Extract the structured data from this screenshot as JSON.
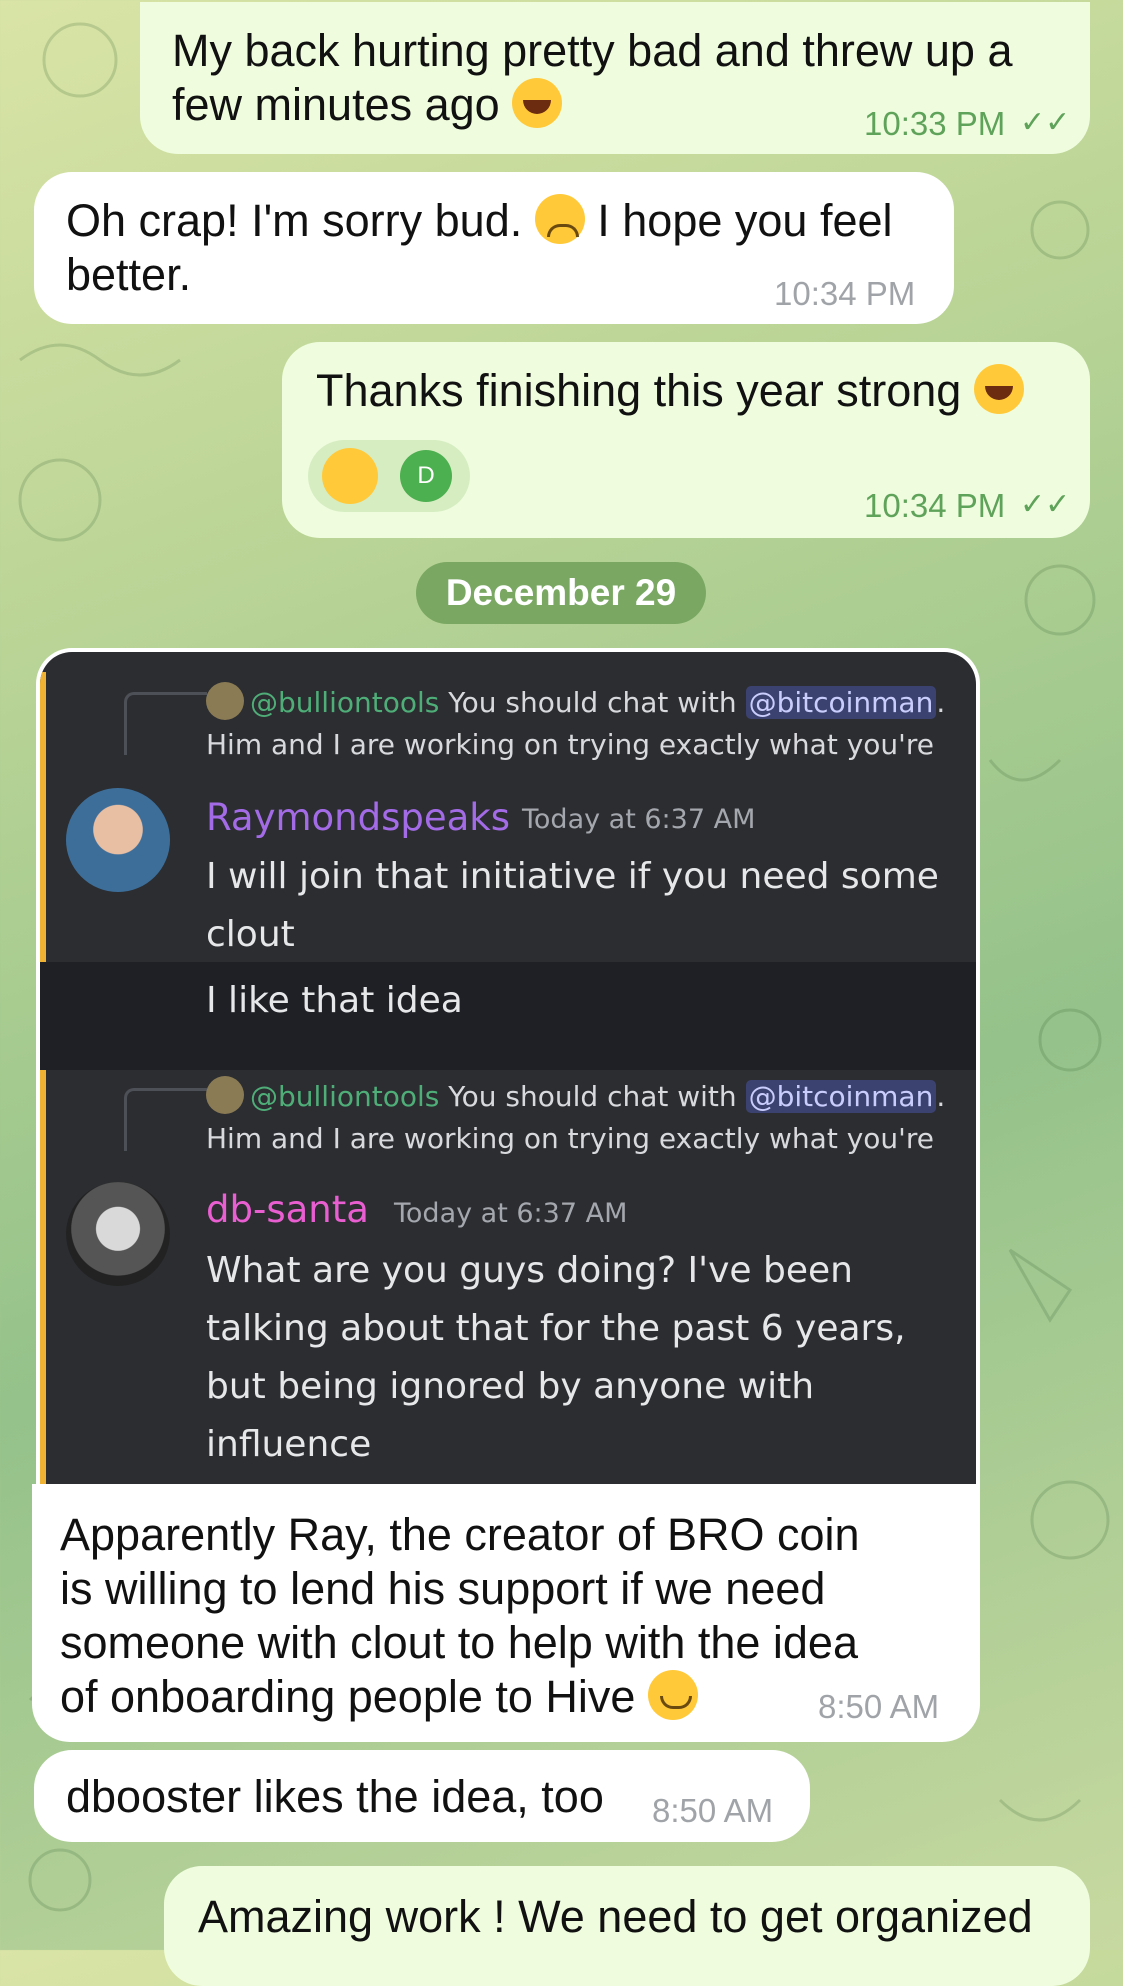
{
  "chat": {
    "date_separator": "December 29",
    "messages": [
      {
        "dir": "out",
        "text_lines": [
          "My back hurting pretty bad and threw up a",
          "few minutes ago"
        ],
        "emoji": "rolling-laughing-emoji",
        "time": "10:33 PM",
        "ticks": "✓✓"
      },
      {
        "dir": "in",
        "text_lines": [
          "Oh crap! I'm sorry bud.",
          " I hope you feel",
          "better."
        ],
        "emoji": "disappointed-face-emoji",
        "time": "10:34 PM"
      },
      {
        "dir": "out",
        "text": "Thanks finishing this year strong",
        "emoji": "rolling-laughing-emoji",
        "reaction_avatar_letter": "D",
        "time": "10:34 PM",
        "ticks": "✓✓"
      },
      {
        "dir": "in",
        "text_lines": [
          "Apparently Ray, the creator of BRO coin",
          "is willing to lend his support if we need",
          "someone with clout to help with the idea",
          "of onboarding people to Hive"
        ],
        "emoji": "smiling-face-emoji",
        "time": "8:50 AM"
      },
      {
        "dir": "in",
        "text": "dbooster likes the idea, too",
        "time": "8:50 AM"
      },
      {
        "dir": "out",
        "text": "Amazing work ! We need to get organized"
      }
    ]
  },
  "screenshot": {
    "blocks": [
      {
        "reply": {
          "user": "@bulliontools",
          "text_before": " You should chat with ",
          "mention": "@bitcoinman",
          "text_after": ".",
          "line2": "Him and I are working on trying exactly what you're"
        },
        "username": "Raymondspeaks",
        "username_color": "#a46be7",
        "timestamp": "Today at 6:37 AM",
        "lines": [
          "I will join that initiative if you need some",
          "clout"
        ],
        "followup": "I like that idea"
      },
      {
        "reply": {
          "user": "@bulliontools",
          "text_before": " You should chat with ",
          "mention": "@bitcoinman",
          "text_after": ".",
          "line2": "Him and I are working on trying exactly what you're"
        },
        "username": "db-santa",
        "username_color": "#e95fd2",
        "timestamp": "Today at 6:37 AM",
        "lines": [
          "What are you guys doing? I've been",
          "talking about that for the past 6 years,",
          "but being ignored by anyone with",
          "influence"
        ]
      }
    ]
  }
}
